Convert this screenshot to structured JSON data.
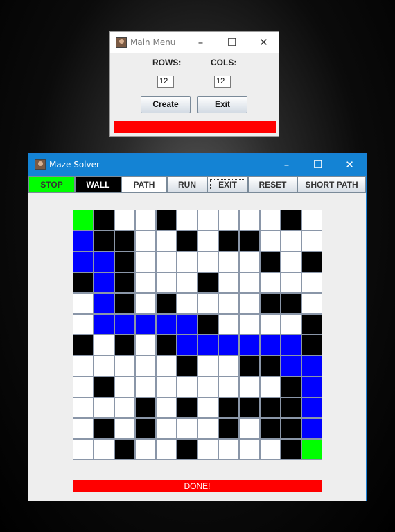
{
  "main_menu": {
    "title": "Main Menu",
    "rows_label": "ROWS:",
    "cols_label": "COLS:",
    "rows_value": "12",
    "cols_value": "12",
    "create_label": "Create",
    "exit_label": "Exit",
    "status_color": "#ff0000"
  },
  "maze_window": {
    "title": "Maze Solver",
    "toolbar": [
      {
        "name": "stop-button",
        "label": "STOP",
        "bg": "#00ff00",
        "color": "#333333"
      },
      {
        "name": "wall-button",
        "label": "WALL",
        "bg": "#000000",
        "color": "#ffffff"
      },
      {
        "name": "path-button",
        "label": "PATH",
        "bg": "#ffffff",
        "color": "#333333"
      },
      {
        "name": "run-button",
        "label": "RUN",
        "bg": "",
        "color": "#333333"
      },
      {
        "name": "exit-button",
        "label": "EXIT",
        "bg": "",
        "color": "#333333"
      },
      {
        "name": "reset-button",
        "label": "RESET",
        "bg": "",
        "color": "#333333"
      },
      {
        "name": "short-path-button",
        "label": "SHORT PATH",
        "bg": "",
        "color": "#333333"
      }
    ],
    "status_text": "DONE!",
    "colors": {
      "W": "#ffffff",
      "B": "#000000",
      "P": "#0000ff",
      "S": "#00ff00",
      "E": "#00ff00"
    },
    "grid": [
      "SBWWBWWWWWBW",
      "PBBWWBWBBWWW",
      "PPBWWWWWWBWB",
      "BPBWWWBWWWWW",
      "WPBWBWWWWBBW",
      "WPPPPPBWWWWB",
      "BWBWBPPPPPPB",
      "WWWWWBWWBBPP",
      "WBWWWWWWWWBP",
      "WWWBWBWBBBBP",
      "WBWBWWWBWBBP",
      "WWBWWBWWWWBE"
    ]
  }
}
